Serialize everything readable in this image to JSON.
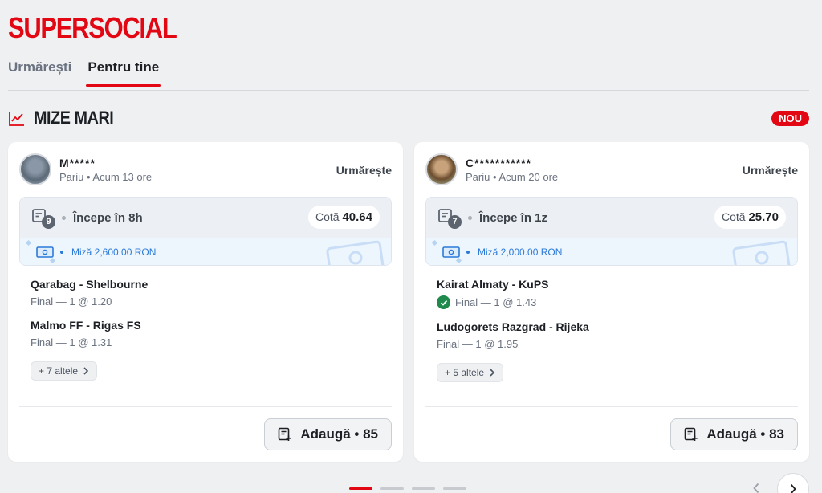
{
  "brand": "SUPERSOCIAL",
  "tabs": [
    {
      "label": "Urmărești",
      "active": false
    },
    {
      "label": "Pentru tine",
      "active": true
    }
  ],
  "section": {
    "title": "MIZE MARI",
    "badge": "NOU",
    "icon": "trend-up-icon"
  },
  "colors": {
    "brand_red": "#e30613",
    "stake_blue": "#2b7ad8",
    "won_green": "#1f8a4c"
  },
  "cards": [
    {
      "user_name": "M*****",
      "meta_type": "Pariu",
      "meta_time": "Acum 13 ore",
      "follow_label": "Urmărește",
      "selections_count": "9",
      "starts_in": "Începe în 8h",
      "odds_label": "Cotă",
      "odds_value": "40.64",
      "stake": "Miză 2,600.00 RON",
      "matches": [
        {
          "name": "Qarabag - Shelbourne",
          "pick": "Final — 1 @ 1.20",
          "won": false
        },
        {
          "name": "Malmo FF - Rigas FS",
          "pick": "Final — 1 @ 1.31",
          "won": false
        }
      ],
      "more_label": "+ 7 altele",
      "add_label": "Adaugă • 85"
    },
    {
      "user_name": "C***********",
      "meta_type": "Pariu",
      "meta_time": "Acum 20 ore",
      "follow_label": "Urmărește",
      "selections_count": "7",
      "starts_in": "Începe în 1z",
      "odds_label": "Cotă",
      "odds_value": "25.70",
      "stake": "Miză 2,000.00 RON",
      "matches": [
        {
          "name": "Kairat Almaty - KuPS",
          "pick": "Final — 1 @ 1.43",
          "won": true
        },
        {
          "name": "Ludogorets Razgrad - Rijeka",
          "pick": "Final — 1 @ 1.95",
          "won": false
        }
      ],
      "more_label": "+ 5 altele",
      "add_label": "Adaugă • 83"
    }
  ],
  "pager": {
    "pages": 4,
    "current": 1
  }
}
